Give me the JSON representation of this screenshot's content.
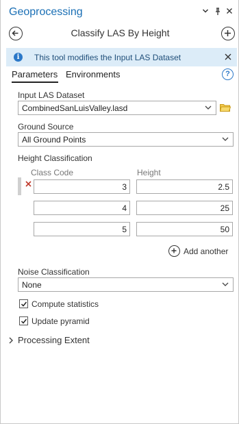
{
  "pane": {
    "title": "Geoprocessing",
    "tool_name": "Classify LAS By Height"
  },
  "info": {
    "message": "This tool modifies the Input LAS Dataset"
  },
  "tabs": [
    {
      "label": "Parameters"
    },
    {
      "label": "Environments"
    }
  ],
  "params": {
    "input_las": {
      "label": "Input LAS Dataset",
      "value": "CombinedSanLuisValley.lasd"
    },
    "ground_source": {
      "label": "Ground Source",
      "value": "All Ground Points"
    },
    "height_classification": {
      "label": "Height Classification",
      "col_class": "Class Code",
      "col_height": "Height",
      "rows": [
        {
          "class_code": "3",
          "height": "2.5"
        },
        {
          "class_code": "4",
          "height": "25"
        },
        {
          "class_code": "5",
          "height": "50"
        }
      ],
      "add_label": "Add another"
    },
    "noise": {
      "label": "Noise Classification",
      "value": "None"
    },
    "compute_stats": {
      "label": "Compute statistics",
      "checked": true
    },
    "update_pyramid": {
      "label": "Update pyramid",
      "checked": true
    },
    "processing_extent": {
      "label": "Processing Extent"
    }
  },
  "icons": {
    "title_menu": "chevron-down-icon",
    "pin": "pin-icon",
    "close": "close-icon",
    "back": "back-arrow-icon",
    "add_tool": "plus-circle-icon",
    "info": "info-icon",
    "help": "help-icon",
    "folder": "folder-icon",
    "delete_row": "delete-x-icon"
  },
  "colors": {
    "accent": "#1a6fb5",
    "info_bg": "#dcecf8",
    "delete": "#c0392b"
  }
}
